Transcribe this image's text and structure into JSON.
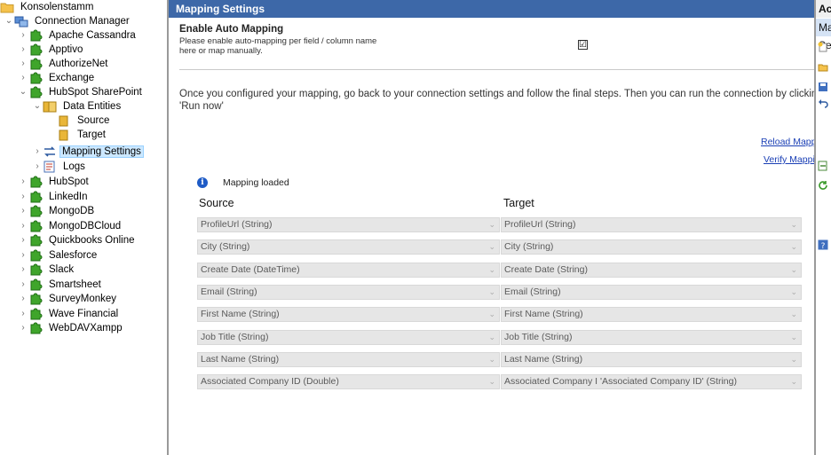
{
  "tree": {
    "root": "Konsolenstamm",
    "connection_manager": "Connection Manager",
    "items_before": [
      "Apache Cassandra",
      "Apptivo",
      "AuthorizeNet",
      "Exchange"
    ],
    "hubspot_sharepoint": "HubSpot SharePoint",
    "data_entities": "Data Entities",
    "source": "Source",
    "target": "Target",
    "mapping_settings": "Mapping Settings",
    "logs": "Logs",
    "items_after": [
      "HubSpot",
      "LinkedIn",
      "MongoDB",
      "MongoDBCloud",
      "Quickbooks Online",
      "Salesforce",
      "Slack",
      "Smartsheet",
      "SurveyMonkey",
      "Wave Financial",
      "WebDAVXampp"
    ]
  },
  "main": {
    "header": "Mapping Settings",
    "auto_mapping_title": "Enable Auto Mapping",
    "auto_mapping_desc_line1": "Please enable auto-mapping per field / column name",
    "auto_mapping_desc_line2": "here or map manually.",
    "auto_mapping_checked": true,
    "check_glyph": "☑",
    "info_line1": "Once you configured your mapping, go back to your connection settings and follow the final steps. Then you can run the connection by clicking on",
    "info_line2": "'Run now'",
    "reload_link": "Reload Mapping",
    "verify_link": "Verify Mapping",
    "status_icon": "i",
    "status_text": "Mapping loaded",
    "source_header": "Source",
    "target_header": "Target",
    "mappings": [
      {
        "source": "ProfileUrl (String)",
        "target": "ProfileUrl (String)"
      },
      {
        "source": "City (String)",
        "target": "City (String)"
      },
      {
        "source": "Create Date (DateTime)",
        "target": "Create Date (String)"
      },
      {
        "source": "Email (String)",
        "target": "Email (String)"
      },
      {
        "source": "First Name (String)",
        "target": "First Name (String)"
      },
      {
        "source": "Job Title (String)",
        "target": "Job Title (String)"
      },
      {
        "source": "Last Name (String)",
        "target": "Last Name (String)"
      },
      {
        "source": "Associated Company ID (Double)",
        "target": "Associated Company I 'Associated Company ID' (String)"
      }
    ]
  },
  "actions": {
    "header": "Actions",
    "sub": "Mapping Settings"
  },
  "colors": {
    "header_blue": "#3d68a8",
    "selection": "#cce8ff",
    "link": "#1a3fb5",
    "combo_bg": "#e6e6e6"
  },
  "icons": {
    "connector": "puzzle-piece-icon",
    "folder": "folder-icon",
    "entity": "table-icon",
    "mapping": "mapping-arrows-icon",
    "logs": "log-icon",
    "dropdown": "chevron-down-icon"
  }
}
